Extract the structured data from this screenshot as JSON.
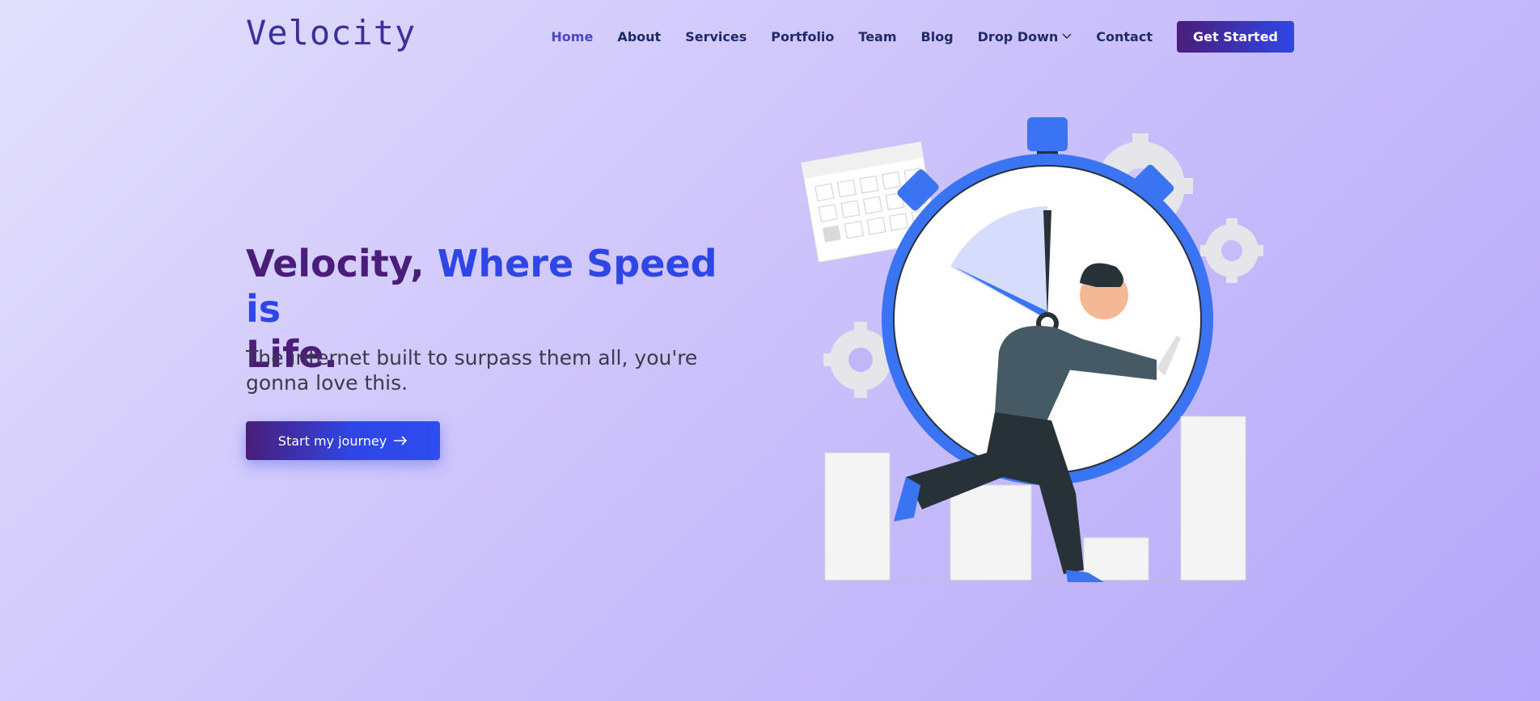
{
  "header": {
    "logo": "Velocity",
    "nav": [
      {
        "label": "Home"
      },
      {
        "label": "About"
      },
      {
        "label": "Services"
      },
      {
        "label": "Portfolio"
      },
      {
        "label": "Team"
      },
      {
        "label": "Blog"
      },
      {
        "label": "Drop Down"
      },
      {
        "label": "Contact"
      }
    ],
    "cta_label": "Get Started"
  },
  "hero": {
    "title_part1": "Velocity, ",
    "title_part2": "Where Speed is",
    "title_part3": "Life.",
    "subtitle": "The internet built to surpass them all, you're gonna love this.",
    "button_label": "Start my journey"
  },
  "colors": {
    "brand_purple": "#4a1d7a",
    "brand_blue": "#2f46e6",
    "nav_text": "#1e2a6b",
    "nav_active": "#4a47c9"
  }
}
